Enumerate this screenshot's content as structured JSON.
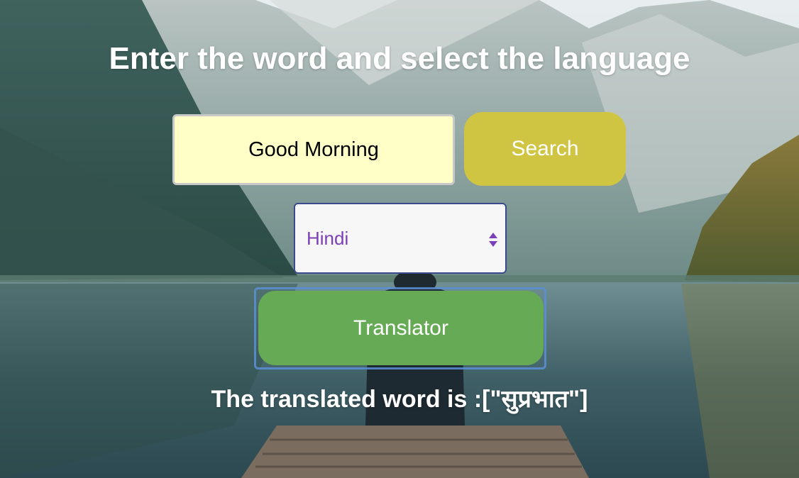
{
  "heading": "Enter the word and select the language",
  "word_input": {
    "value": "Good Morning"
  },
  "search_button": {
    "label": "Search"
  },
  "language_select": {
    "selected": "Hindi"
  },
  "translate_button": {
    "label": "Translator"
  },
  "result": {
    "text": "The translated word is :[\"सुप्रभात\"]"
  },
  "background": {
    "description_icon": "mountain-lake-photo"
  },
  "colors": {
    "input_bg": "#ffffc8",
    "search_bg": "#d0c443",
    "translate_bg": "#67aa56",
    "select_text": "#7b3fb8",
    "text": "#ffffff"
  }
}
